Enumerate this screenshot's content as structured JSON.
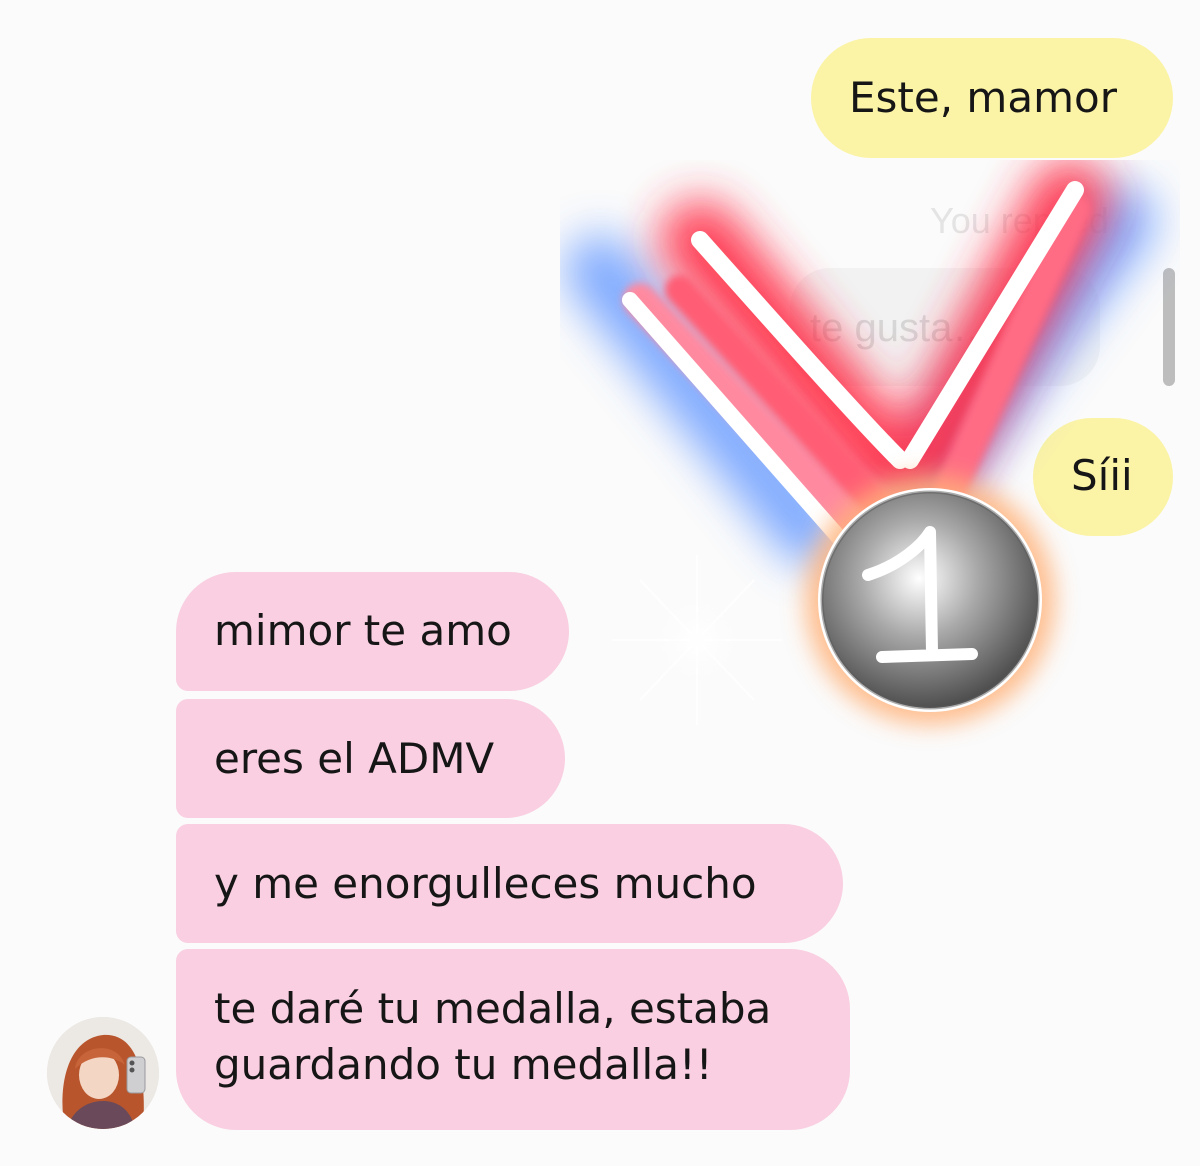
{
  "conversation": {
    "outgoing": [
      {
        "text": "Este, mamor"
      },
      {
        "text": "Síii"
      }
    ],
    "reply_context": {
      "label": "You replied",
      "quoted": "te gusta…u"
    },
    "incoming": [
      {
        "text": "mimor te amo"
      },
      {
        "text": "eres el ADMV"
      },
      {
        "text": "y me enorgulleces mucho"
      },
      {
        "text": "te daré tu medalla, estaba\nguardando tu medalla!!"
      }
    ],
    "sticker": {
      "icon": "first-place-medal-icon",
      "digit": "1"
    },
    "avatar": {
      "icon": "user-avatar-photo"
    }
  },
  "colors": {
    "outgoing_bubble": "#fbf3a6",
    "incoming_bubble": "#f9cfe1",
    "ribbon_red": "#ff3b4e",
    "ribbon_blue": "#5a93ff",
    "medal_gray": "#6e6e6e"
  }
}
